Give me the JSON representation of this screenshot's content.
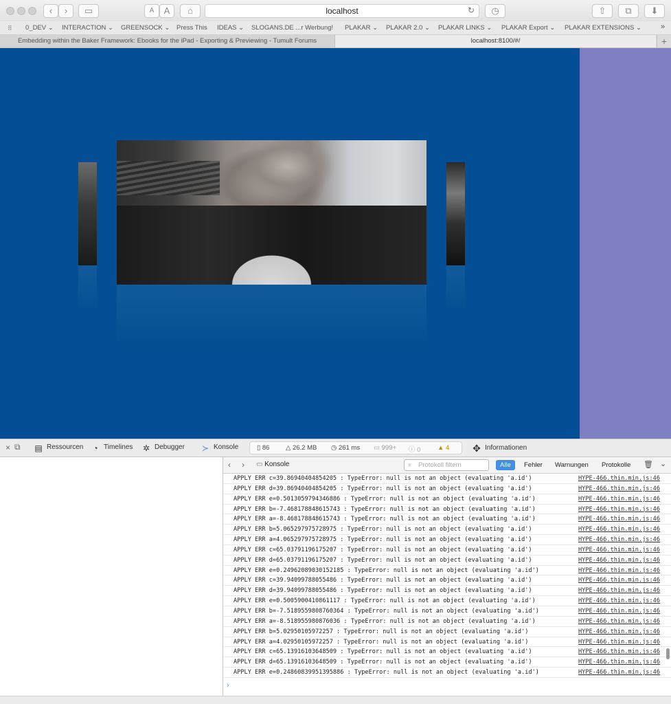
{
  "browser": {
    "url": "localhost",
    "nav_back": "‹",
    "nav_forward": "›",
    "font_small": "A",
    "font_large": "A",
    "bookmarks": [
      "0_DEV ⌄",
      "INTERACTION ⌄",
      "GREENSOCK ⌄",
      "Press This",
      "IDEAS ⌄",
      "SLOGANS.DE ...r Werbung!",
      "PLAKAR ⌄",
      "PLAKAR 2.0 ⌄",
      "PLAKAR LINKS ⌄",
      "PLAKAR Export ⌄",
      "PLAKAR EXTENSIONS ⌄"
    ],
    "bookmarks_overflow": "»",
    "tabs": [
      "Embedding within the Baker Framework: Ebooks for the iPad - Exporting & Previewing - Tumult Forums",
      "localhost:8100/#/"
    ],
    "new_tab": "+"
  },
  "page": {
    "stage_color": "#034e94",
    "side_color": "#7f7fc4"
  },
  "inspector": {
    "tabs": {
      "resources": "Ressourcen",
      "timelines": "Timelines",
      "debugger": "Debugger",
      "console": "Konsole",
      "info": "Informationen"
    },
    "stats": {
      "resources": "86",
      "size": "26.2 MB",
      "time": "261 ms",
      "logs": "999+",
      "errors": "0",
      "warnings": "4"
    },
    "console_bar": {
      "title": "Konsole",
      "filter_placeholder": "Protokoll filtern",
      "scopes": [
        "Alle",
        "Fehler",
        "Warnungen",
        "Protokolle"
      ]
    },
    "log_source": "HYPE-466.thin.min.js:46",
    "log_rows": [
      "APPLY ERR c=39.86940404854205 : TypeError: null is not an object (evaluating 'a.id')",
      "APPLY ERR d=39.86940404854205 : TypeError: null is not an object (evaluating 'a.id')",
      "APPLY ERR e=0.5013059794346886 : TypeError: null is not an object (evaluating 'a.id')",
      "APPLY ERR b=-7.468178848615743 : TypeError: null is not an object (evaluating 'a.id')",
      "APPLY ERR a=-8.468178848615743 : TypeError: null is not an object (evaluating 'a.id')",
      "APPLY ERR b=5.065297975728975 : TypeError: null is not an object (evaluating 'a.id')",
      "APPLY ERR a=4.065297975728975 : TypeError: null is not an object (evaluating 'a.id')",
      "APPLY ERR c=65.03791196175207 : TypeError: null is not an object (evaluating 'a.id')",
      "APPLY ERR d=65.03791196175207 : TypeError: null is not an object (evaluating 'a.id')",
      "APPLY ERR e=0.24962089030152185 : TypeError: null is not an object (evaluating 'a.id')",
      "APPLY ERR c=39.94099788055486 : TypeError: null is not an object (evaluating 'a.id')",
      "APPLY ERR d=39.94099788055486 : TypeError: null is not an object (evaluating 'a.id')",
      "APPLY ERR e=0.5005900410861117 : TypeError: null is not an object (evaluating 'a.id')",
      "APPLY ERR b=-7.5189559808760364 : TypeError: null is not an object (evaluating 'a.id')",
      "APPLY ERR a=-8.518955980876036 : TypeError: null is not an object (evaluating 'a.id')",
      "APPLY ERR b=5.02950105972257 : TypeError: null is not an object (evaluating 'a.id')",
      "APPLY ERR a=4.02950105972257 : TypeError: null is not an object (evaluating 'a.id')",
      "APPLY ERR c=65.13916103648509 : TypeError: null is not an object (evaluating 'a.id')",
      "APPLY ERR d=65.13916103648509 : TypeError: null is not an object (evaluating 'a.id')",
      "APPLY ERR e=0.24860839951395886 : TypeError: null is not an object (evaluating 'a.id')"
    ],
    "prompt": "›"
  }
}
